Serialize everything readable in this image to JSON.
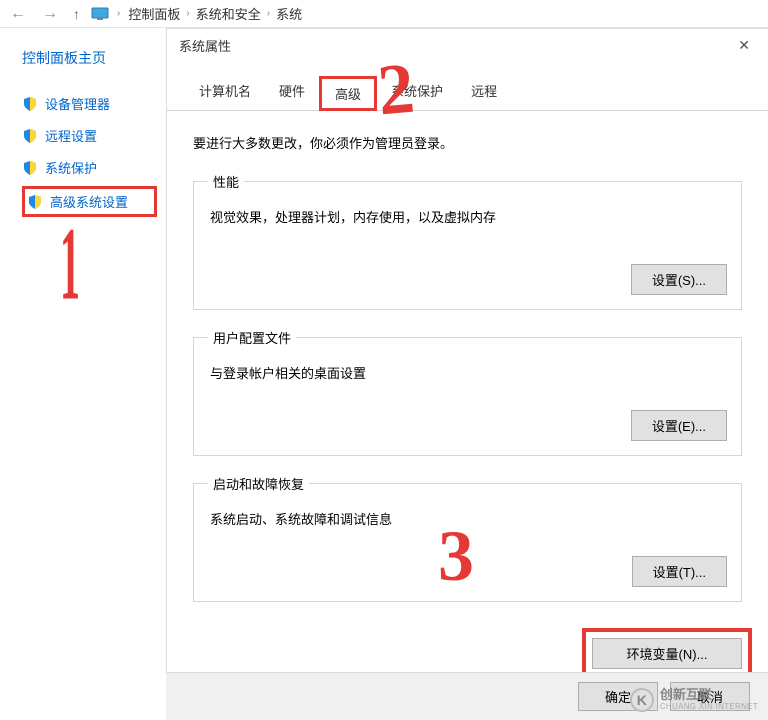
{
  "breadcrumb": {
    "item1": "控制面板",
    "item2": "系统和安全",
    "item3": "系统"
  },
  "sidebar": {
    "title": "控制面板主页",
    "items": [
      {
        "label": "设备管理器"
      },
      {
        "label": "远程设置"
      },
      {
        "label": "系统保护"
      },
      {
        "label": "高级系统设置"
      }
    ]
  },
  "dialog": {
    "title": "系统属性",
    "tabs": [
      {
        "label": "计算机名"
      },
      {
        "label": "硬件"
      },
      {
        "label": "高级"
      },
      {
        "label": "系统保护"
      },
      {
        "label": "远程"
      }
    ],
    "instruction": "要进行大多数更改，你必须作为管理员登录。",
    "perf": {
      "legend": "性能",
      "desc": "视觉效果，处理器计划，内存使用，以及虚拟内存",
      "btn": "设置(S)..."
    },
    "profile": {
      "legend": "用户配置文件",
      "desc": "与登录帐户相关的桌面设置",
      "btn": "设置(E)..."
    },
    "startup": {
      "legend": "启动和故障恢复",
      "desc": "系统启动、系统故障和调试信息",
      "btn": "设置(T)..."
    },
    "envbtn": "环境变量(N)...",
    "ok": "确定",
    "cancel": "取消"
  },
  "watermark": {
    "cn": "创新互联",
    "en": "CHUANG XIN INTERNET"
  },
  "annotations": {
    "n1": "1",
    "n2": "2",
    "n3": "3"
  }
}
